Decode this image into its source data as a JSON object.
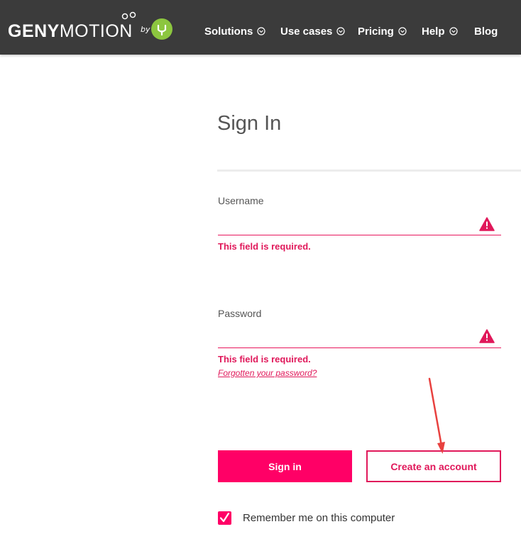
{
  "colors": {
    "topbar": "#3b3b3b",
    "accent": "#ff0066",
    "error": "#e0185a",
    "logo_badge": "#8cc63f"
  },
  "brand": {
    "logo_bold": "GENY",
    "logo_light": "MOTION",
    "logo_by": "by",
    "logo_icon": "genymobile-badge-icon"
  },
  "nav": {
    "items": [
      {
        "label": "Solutions",
        "has_dropdown": true
      },
      {
        "label": "Use cases",
        "has_dropdown": true
      },
      {
        "label": "Pricing",
        "has_dropdown": true
      },
      {
        "label": "Help",
        "has_dropdown": true
      },
      {
        "label": "Blog",
        "has_dropdown": false
      }
    ]
  },
  "form": {
    "title": "Sign In",
    "username": {
      "label": "Username",
      "value": "",
      "error": "This field is required.",
      "icon": "warning-icon"
    },
    "password": {
      "label": "Password",
      "value": "",
      "error": "This field is required.",
      "icon": "warning-icon"
    },
    "forgot_link": "Forgotten your password?",
    "sign_in_label": "Sign in",
    "create_account_label": "Create an account",
    "remember_label": "Remember me on this computer",
    "remember_checked": true
  }
}
